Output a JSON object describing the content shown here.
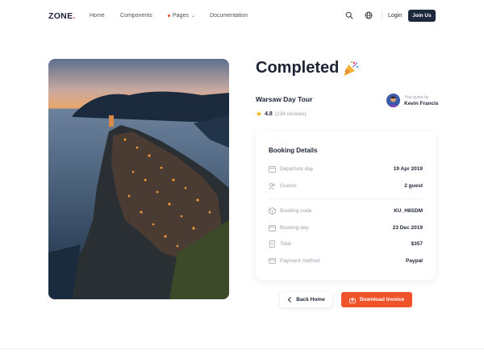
{
  "nav": {
    "logo": "ZONE",
    "logo_dot": ".",
    "links": {
      "home": "Home",
      "components": "Components",
      "pages": "Pages",
      "docs": "Documentation"
    },
    "login": "Login",
    "join": "Join Us",
    "icons": [
      "search-icon",
      "globe-icon",
      "chevron-down-icon"
    ]
  },
  "hero": {
    "image": "coastal-village-at-dusk"
  },
  "booking": {
    "title": "Completed",
    "title_icon": "party-popper-icon",
    "tour_name": "Warsaw Day Tour",
    "rating": "4.8",
    "reviews": "(234 reviews)",
    "guide_label": "Your guide by",
    "guide_name": "Kevin Francis",
    "card_title": "Booking Details",
    "rows": [
      {
        "icon": "calendar-icon",
        "label": "Departure day",
        "value": "19 Apr 2019"
      },
      {
        "icon": "users-icon",
        "label": "Guests",
        "value": "2 guest"
      },
      {
        "icon": "box-icon",
        "label": "Booking code",
        "value": "KU_H8SDM"
      },
      {
        "icon": "calendar-icon",
        "label": "Booking day",
        "value": "23 Dec 2019"
      },
      {
        "icon": "receipt-icon",
        "label": "Total",
        "value": "$357"
      },
      {
        "icon": "card-icon",
        "label": "Payment method",
        "value": "Paypal"
      }
    ]
  },
  "actions": {
    "back": "Back Home",
    "download": "Download Invoice"
  },
  "colors": {
    "accent": "#f0532a",
    "dark": "#1e2a3b",
    "star": "#f5b301"
  }
}
